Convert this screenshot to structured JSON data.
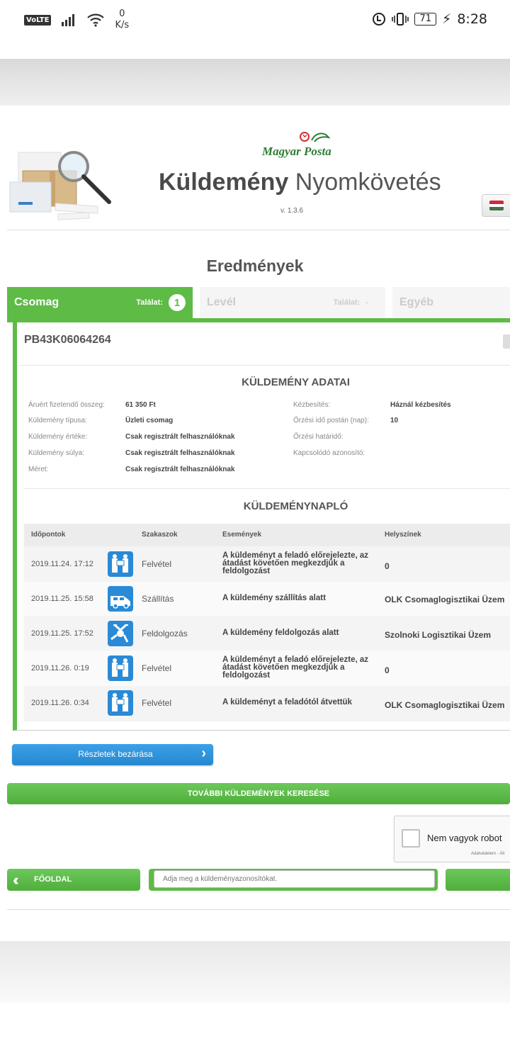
{
  "status_bar": {
    "volte": "VoLTE",
    "speed_value": "0",
    "speed_unit": "K/s",
    "battery": "71",
    "time": "8:28"
  },
  "header": {
    "logo_text": "Magyar Posta",
    "title_bold": "Küldemény",
    "title_rest": " Nyomkövetés",
    "version": "v. 1.3.6"
  },
  "results": {
    "heading": "Eredmények",
    "tabs": [
      {
        "label": "Csomag",
        "hits_label": "Találat:",
        "hits": "1"
      },
      {
        "label": "Levél",
        "hits_label": "Találat:",
        "hits": "-"
      },
      {
        "label": "Egyéb"
      }
    ]
  },
  "shipment": {
    "tracking_number": "PB43K06064264",
    "data_title": "KÜLDEMÉNY ADATAI",
    "left_fields": [
      {
        "label": "Áruért fizetendő összeg:",
        "value": "61 350 Ft"
      },
      {
        "label": "Küldemény típusa:",
        "value": "Üzleti csomag"
      },
      {
        "label": "Küldemény értéke:",
        "value": "Csak regisztrált felhasználóknak"
      },
      {
        "label": "Küldemény súlya:",
        "value": "Csak regisztrált felhasználóknak"
      },
      {
        "label": "Méret:",
        "value": "Csak regisztrált felhasználóknak"
      }
    ],
    "right_fields": [
      {
        "label": "Kézbesítés:",
        "value": "Háznál kézbesítés"
      },
      {
        "label": "Őrzési idő postán (nap):",
        "value": "10"
      },
      {
        "label": "Őrzési határidő:",
        "value": ""
      },
      {
        "label": "Kapcsolódó azonosító:",
        "value": ""
      }
    ]
  },
  "log": {
    "title": "KÜLDEMÉNYNAPLÓ",
    "headers": [
      "Időpontok",
      "Szakaszok",
      "Események",
      "Helyszínek"
    ],
    "rows": [
      {
        "time": "2019.11.24. 17:12",
        "icon": "handover-icon",
        "stage": "Felvétel",
        "event": "A küldeményt a feladó előrejelezte, az átadást követően megkezdjük a feldolgozást",
        "location": "0"
      },
      {
        "time": "2019.11.25. 15:58",
        "icon": "van-icon",
        "stage": "Szállítás",
        "event": "A küldemény szállítás alatt",
        "location": "OLK Csomaglogisztikai Üzem"
      },
      {
        "time": "2019.11.25. 17:52",
        "icon": "sorting-icon",
        "stage": "Feldolgozás",
        "event": "A küldemény feldolgozás alatt",
        "location": "Szolnoki Logisztikai Üzem"
      },
      {
        "time": "2019.11.26. 0:19",
        "icon": "handover-icon",
        "stage": "Felvétel",
        "event": "A küldeményt a feladó előrejelezte, az átadást követően megkezdjük a feldolgozást",
        "location": "0"
      },
      {
        "time": "2019.11.26. 0:34",
        "icon": "handover-icon",
        "stage": "Felvétel",
        "event": "A küldeményt a feladótól átvettük",
        "location": "OLK Csomaglogisztikai Üzem"
      }
    ]
  },
  "actions": {
    "close_details": "Részletek bezárása",
    "more_search": "TOVÁBBI KÜLDEMÉNYEK KERESÉSE",
    "captcha_label": "Nem vagyok robot",
    "captcha_footer": "Adatvédelem - Ált",
    "home": "FŐOLDAL",
    "search_placeholder": "Adja meg a küldeményazonosítókat."
  },
  "colors": {
    "brand_green": "#5dbb46",
    "accent_blue": "#2a8ad6"
  }
}
